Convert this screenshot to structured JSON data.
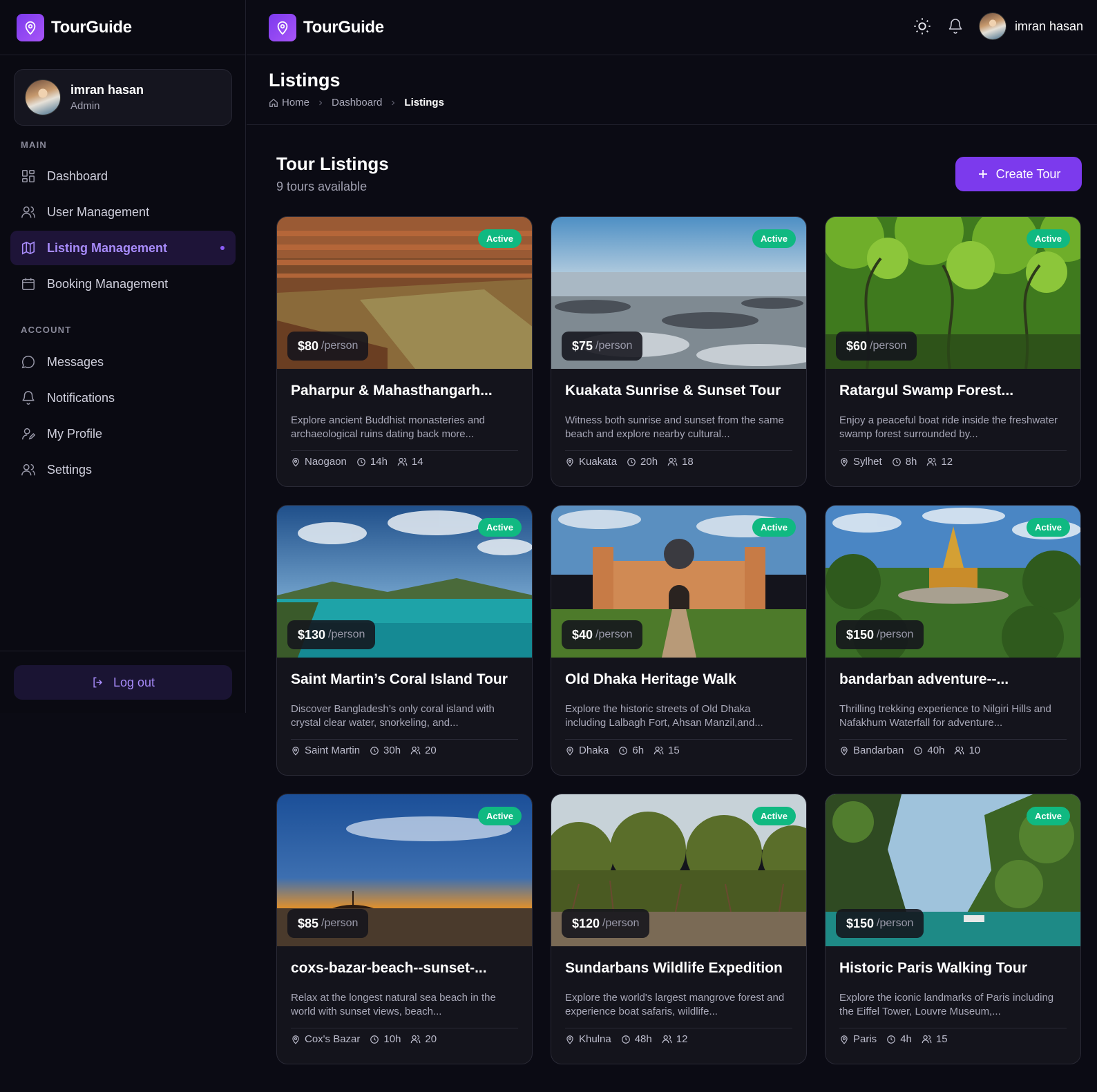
{
  "brand": {
    "name": "TourGuide"
  },
  "user": {
    "name": "imran hasan",
    "role": "Admin"
  },
  "sidebar": {
    "main_label": "MAIN",
    "account_label": "ACCOUNT",
    "main_items": [
      {
        "label": "Dashboard",
        "icon": "grid-icon"
      },
      {
        "label": "User Management",
        "icon": "users-icon"
      },
      {
        "label": "Listing Management",
        "icon": "map-icon",
        "active": true
      },
      {
        "label": "Booking Management",
        "icon": "calendar-icon"
      }
    ],
    "account_items": [
      {
        "label": "Messages",
        "icon": "message-icon"
      },
      {
        "label": "Notifications",
        "icon": "bell-icon"
      },
      {
        "label": "My Profile",
        "icon": "user-edit-icon"
      },
      {
        "label": "Settings",
        "icon": "users-icon"
      }
    ],
    "logout_label": "Log out"
  },
  "header": {
    "page_title": "Listings",
    "breadcrumb": [
      "Home",
      "Dashboard",
      "Listings"
    ]
  },
  "content": {
    "title": "Tour Listings",
    "subtitle": "9 tours available",
    "create_label": "Create Tour"
  },
  "listings": [
    {
      "title": "Paharpur & Mahasthangarh...",
      "desc": "Explore ancient Buddhist monasteries and archaeological ruins dating back more...",
      "price": "$80",
      "unit": "/person",
      "status": "Active",
      "location": "Naogaon",
      "duration": "14h",
      "capacity": "14"
    },
    {
      "title": "Kuakata Sunrise & Sunset Tour",
      "desc": "Witness both sunrise and sunset from the same beach and explore nearby cultural...",
      "price": "$75",
      "unit": "/person",
      "status": "Active",
      "location": "Kuakata",
      "duration": "20h",
      "capacity": "18"
    },
    {
      "title": "Ratargul Swamp Forest...",
      "desc": "Enjoy a peaceful boat ride inside the freshwater swamp forest surrounded by...",
      "price": "$60",
      "unit": "/person",
      "status": "Active",
      "location": "Sylhet",
      "duration": "8h",
      "capacity": "12"
    },
    {
      "title": "Saint Martin’s Coral Island Tour",
      "desc": "Discover Bangladesh’s only coral island with crystal clear water, snorkeling, and...",
      "price": "$130",
      "unit": "/person",
      "status": "Active",
      "location": "Saint Martin",
      "duration": "30h",
      "capacity": "20"
    },
    {
      "title": "Old Dhaka Heritage Walk",
      "desc": "Explore the historic streets of Old Dhaka including Lalbagh Fort, Ahsan Manzil,and...",
      "price": "$40",
      "unit": "/person",
      "status": "Active",
      "location": "Dhaka",
      "duration": "6h",
      "capacity": "15"
    },
    {
      "title": "bandarban adventure--...",
      "desc": "Thrilling trekking experience to Nilgiri Hills and Nafakhum Waterfall for adventure...",
      "price": "$150",
      "unit": "/person",
      "status": "Active",
      "location": "Bandarban",
      "duration": "40h",
      "capacity": "10"
    },
    {
      "title": "coxs-bazar-beach--sunset-...",
      "desc": "Relax at the longest natural sea beach in the world with sunset views, beach...",
      "price": "$85",
      "unit": "/person",
      "status": "Active",
      "location": "Cox's Bazar",
      "duration": "10h",
      "capacity": "20"
    },
    {
      "title": "Sundarbans Wildlife Expedition",
      "desc": "Explore the world's largest mangrove forest and experience boat safaris, wildlife...",
      "price": "$120",
      "unit": "/person",
      "status": "Active",
      "location": "Khulna",
      "duration": "48h",
      "capacity": "12"
    },
    {
      "title": "Historic Paris Walking Tour",
      "desc": "Explore the iconic landmarks of Paris including the Eiffel Tower, Louvre Museum,...",
      "price": "$150",
      "unit": "/person",
      "status": "Active",
      "location": "Paris",
      "duration": "4h",
      "capacity": "15"
    }
  ],
  "colors": {
    "accent": "#7c3aed",
    "active_badge": "#10b981",
    "background": "#0b0b14",
    "card": "#14141c"
  }
}
